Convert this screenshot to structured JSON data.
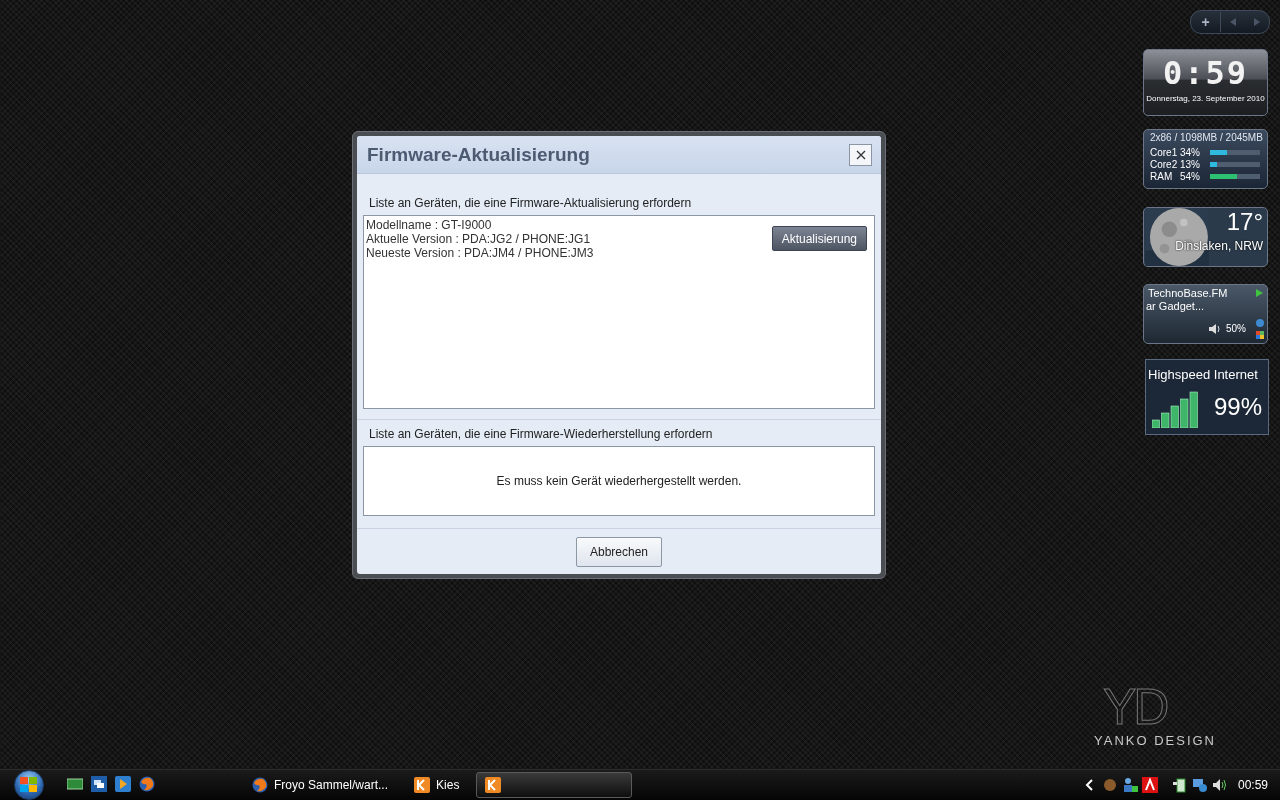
{
  "dialog": {
    "title": "Firmware-Aktualisierung",
    "update_section": {
      "label": "Liste an Geräten, die eine Firmware-Aktualisierung erfordern",
      "device_lines": [
        "Modellname : GT-I9000",
        "Aktuelle Version : PDA:JG2 / PHONE:JG1",
        "Neueste Version : PDA:JM4 / PHONE:JM3"
      ],
      "button": "Aktualisierung"
    },
    "restore_section": {
      "label": "Liste an Geräten, die eine Firmware-Wiederherstellung erfordern",
      "message": "Es muss kein Gerät wiederhergestellt werden."
    },
    "cancel_button": "Abbrechen"
  },
  "gadgets": {
    "toolbar": {
      "add": "+"
    },
    "clock": {
      "time": "0:59",
      "date": "Donnerstag, 23. September 2010"
    },
    "cpu": {
      "header": "2x86 / 1098MB / 2045MB",
      "rows": [
        {
          "name": "Core1",
          "reading": "34%",
          "level": 0.34,
          "color": "#2fb8e0"
        },
        {
          "name": "Core2",
          "reading": "13%",
          "level": 0.13,
          "color": "#2fb8e0"
        },
        {
          "name": "RAM",
          "reading": "54%",
          "level": 0.54,
          "color": "#2cc070"
        }
      ]
    },
    "weather": {
      "temperature": "17°",
      "location": "Dinslaken, NRW"
    },
    "radio": {
      "station": "TechnoBase.FM",
      "subtitle": "ar Gadget...",
      "volume": "50%"
    },
    "network": {
      "title": "Highspeed Internet",
      "reading": "99%"
    }
  },
  "wallpaper": {
    "logo": "YD",
    "brand": "YANKO DESIGN"
  },
  "taskbar": {
    "tasks": [
      {
        "label": "Froyo Sammel/wart...",
        "kind": "firefox",
        "selected": false
      },
      {
        "label": "Kies",
        "kind": "kies",
        "selected": false
      },
      {
        "kind": "kies",
        "selected": true
      }
    ],
    "clock": "00:59"
  }
}
